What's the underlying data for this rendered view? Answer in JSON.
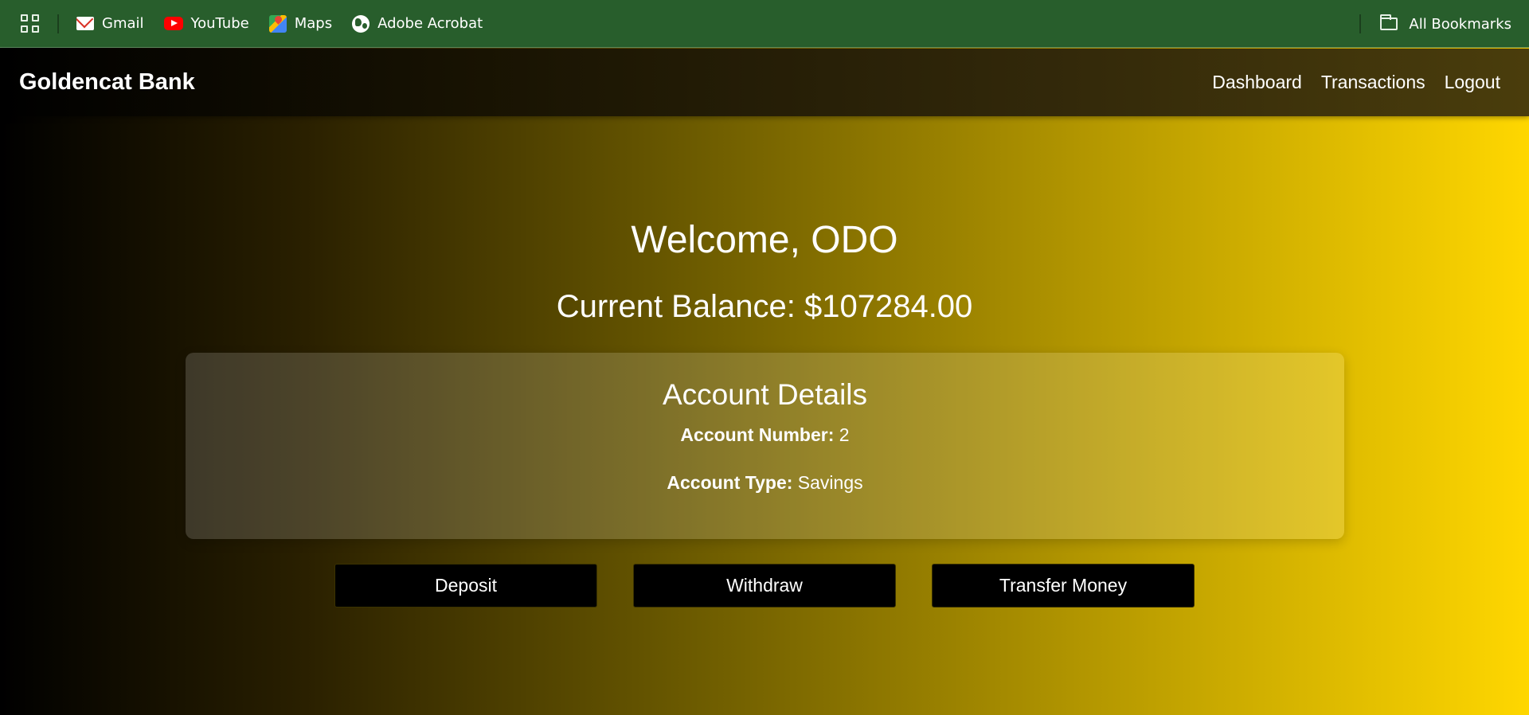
{
  "bookmarks_bar": {
    "items": [
      {
        "label": "Gmail",
        "icon": "gmail-icon"
      },
      {
        "label": "YouTube",
        "icon": "youtube-icon"
      },
      {
        "label": "Maps",
        "icon": "maps-icon"
      },
      {
        "label": "Adobe Acrobat",
        "icon": "globe-icon"
      }
    ],
    "all_bookmarks_label": "All Bookmarks",
    "color": "#285e2c"
  },
  "header": {
    "brand": "Goldencat Bank",
    "nav": {
      "dashboard": "Dashboard",
      "transactions": "Transactions",
      "logout": "Logout"
    }
  },
  "main": {
    "welcome": "Welcome, ODO",
    "balance_label": "Current Balance: ",
    "balance_value": "$107284.00",
    "account_details": {
      "title": "Account Details",
      "number_label": "Account Number:",
      "number_value": "2",
      "type_label": "Account Type:",
      "type_value": "Savings"
    },
    "actions": {
      "deposit": "Deposit",
      "withdraw": "Withdraw",
      "transfer": "Transfer Money"
    }
  },
  "colors": {
    "gradient_start": "#000000",
    "gradient_end": "#ffd700",
    "button_bg": "#000000"
  }
}
